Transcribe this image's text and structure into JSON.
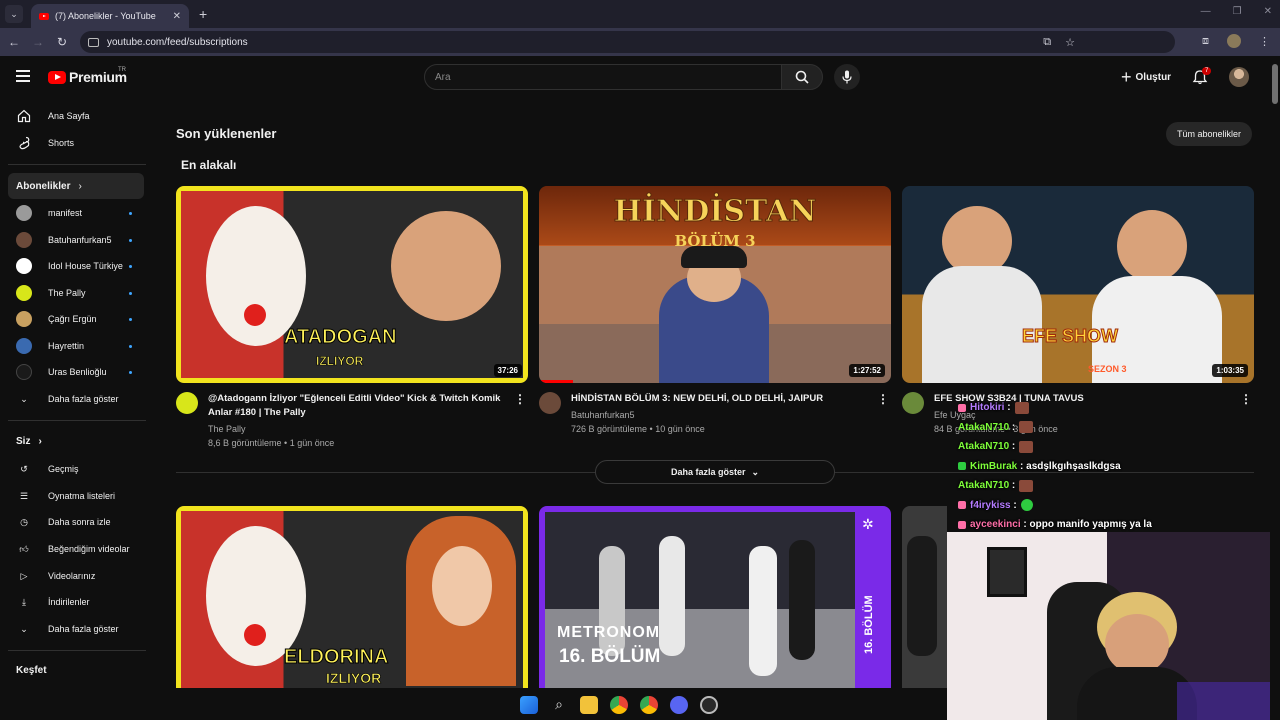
{
  "browser": {
    "tab_title": "(7) Abonelikler - YouTube",
    "url": "youtube.com/feed/subscriptions"
  },
  "masthead": {
    "logo": "Premium",
    "country": "TR",
    "search_placeholder": "Ara",
    "create_label": "Oluştur",
    "notif_count": "7"
  },
  "sidebar": {
    "home": "Ana Sayfa",
    "shorts": "Shorts",
    "subs_head": "Abonelikler",
    "channels": [
      {
        "name": "manifest",
        "color": "#9a9a9a"
      },
      {
        "name": "Batuhanfurkan5",
        "color": "#6b4a3a"
      },
      {
        "name": "Idol House Türkiye",
        "color": "#ffffff"
      },
      {
        "name": "The Pally",
        "color": "#d8e61a"
      },
      {
        "name": "Çağrı Ergün",
        "color": "#c8a060"
      },
      {
        "name": "Hayrettin",
        "color": "#3a6ab0"
      },
      {
        "name": "Uras Benlioğlu",
        "color": "#1a1a1a"
      }
    ],
    "show_more": "Daha fazla göster",
    "you_head": "Siz",
    "you_items": [
      "Geçmiş",
      "Oynatma listeleri",
      "Daha sonra izle",
      "Beğendiğim videolar",
      "Videolarınız",
      "İndirilenler",
      "Daha fazla göster"
    ],
    "explore_head": "Keşfet"
  },
  "content": {
    "title": "Son yüklenenler",
    "all_subs": "Tüm abonelikler",
    "subsection": "En alakalı",
    "show_more": "Daha fazla göster",
    "videos": [
      {
        "title": "@Atadogann İzliyor \"Eğlenceli Editli Video\" Kick & Twitch Komik Anlar #180 | The Pally",
        "channel": "The Pally",
        "stats": "8,6 B görüntüleme • 1 gün önce",
        "duration": "37:26",
        "thumb_text": "ATADOGAN",
        "thumb_sub": "IZLIYOR"
      },
      {
        "title": "HİNDİSTAN BÖLÜM 3: NEW DELHİ, OLD DELHİ, JAIPUR",
        "channel": "Batuhanfurkan5",
        "stats": "726 B görüntüleme • 10 gün önce",
        "duration": "1:27:52",
        "thumb_text": "HİNDİSTAN",
        "thumb_sub": "BÖLÜM 3"
      },
      {
        "title": "EFE SHOW S3B24 | TUNA TAVUS",
        "channel": "Efe Uygaç",
        "stats": "84 B görüntüleme • 3 gün önce",
        "duration": "1:03:35",
        "thumb_text": "EFE SHOW",
        "thumb_sub": "SEZON 3"
      }
    ],
    "row2": [
      {
        "thumb_text": "ELDORINA",
        "thumb_sub": "IZLIYOR"
      },
      {
        "thumb_text": "METRONOM",
        "thumb_sub": "16. BÖLÜM",
        "side": "16. BÖLÜM"
      }
    ]
  },
  "chat": [
    {
      "user": "Hitokiri",
      "msg": "",
      "color": "#b57cff"
    },
    {
      "user": "AtakaN710",
      "msg": "",
      "color": "#7fff3a"
    },
    {
      "user": "AtakaN710",
      "msg": "",
      "color": "#7fff3a"
    },
    {
      "user": "KimBurak",
      "msg": "asdşlkgıhşaslkdgsa",
      "color": "#7fff3a"
    },
    {
      "user": "AtakaN710",
      "msg": "",
      "color": "#7fff3a"
    },
    {
      "user": "f4irykiss",
      "msg": "",
      "color": "#b57cff"
    },
    {
      "user": "ayceekinci",
      "msg": "oppo manifo yapmış ya la",
      "color": "#ff6fa8"
    }
  ]
}
